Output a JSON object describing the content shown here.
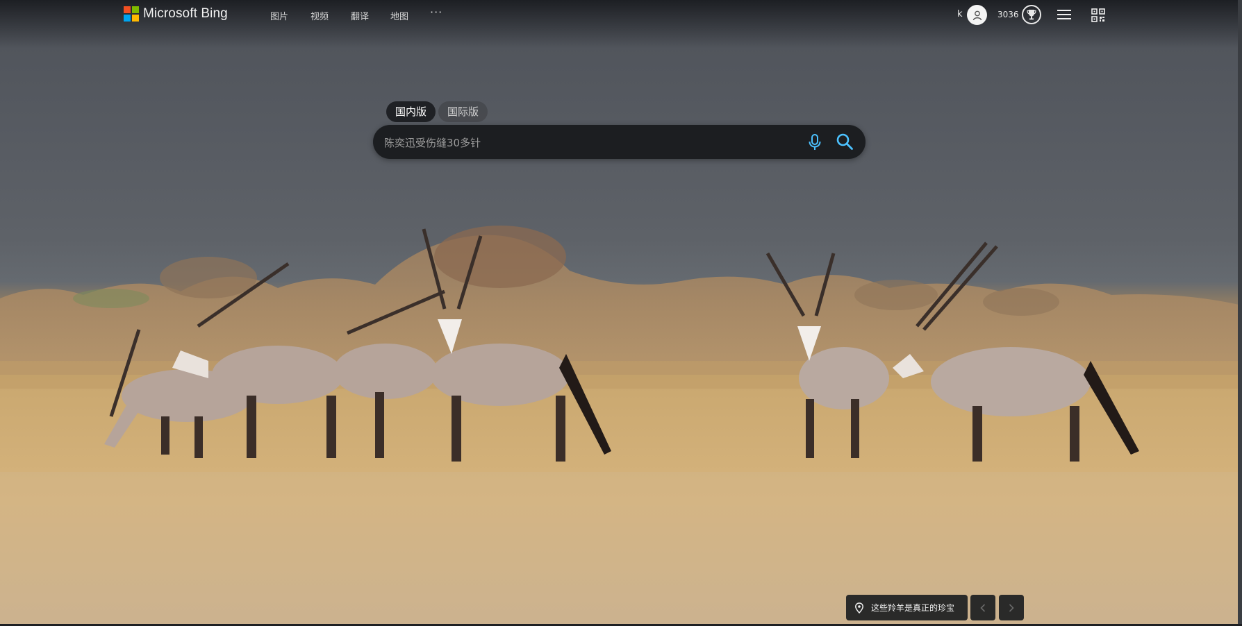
{
  "header": {
    "brand": "Microsoft Bing",
    "logo_colors": [
      "#f25022",
      "#7fba00",
      "#00a4ef",
      "#ffb900"
    ],
    "nav": [
      {
        "label": "图片"
      },
      {
        "label": "视频"
      },
      {
        "label": "翻译"
      },
      {
        "label": "地图"
      }
    ],
    "more_label": "···",
    "user_initial": "k",
    "rewards_points": "3036",
    "icons": [
      "user-avatar-icon",
      "rewards-trophy-icon",
      "hamburger-menu-icon",
      "qr-code-icon"
    ]
  },
  "search": {
    "tabs": [
      {
        "label": "国内版",
        "active": true
      },
      {
        "label": "国际版",
        "active": false
      }
    ],
    "placeholder": "陈奕迅受伤缝30多针",
    "accent_color": "#4cc2ff",
    "icons": [
      "microphone-icon",
      "search-icon"
    ]
  },
  "background": {
    "caption": "这些羚羊是真正的珍宝",
    "caption_icon": "location-pin-icon"
  }
}
